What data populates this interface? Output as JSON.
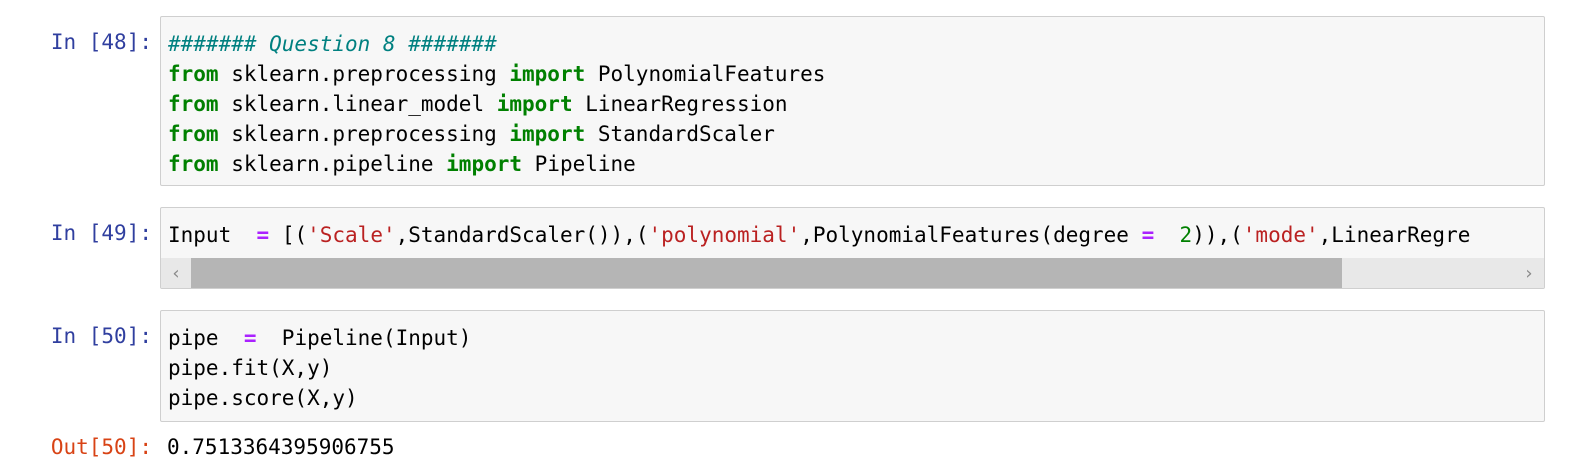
{
  "cells": [
    {
      "prompt": "In [48]:",
      "lines": [
        [
          {
            "t": "####### Question 8 #######",
            "c": "cm"
          }
        ],
        [
          {
            "t": "from",
            "c": "kw"
          },
          {
            "t": " sklearn.preprocessing ",
            "c": ""
          },
          {
            "t": "import",
            "c": "kw"
          },
          {
            "t": " PolynomialFeatures",
            "c": ""
          }
        ],
        [
          {
            "t": "from",
            "c": "kw"
          },
          {
            "t": " sklearn.linear_model ",
            "c": ""
          },
          {
            "t": "import",
            "c": "kw"
          },
          {
            "t": " LinearRegression",
            "c": ""
          }
        ],
        [
          {
            "t": "from",
            "c": "kw"
          },
          {
            "t": " sklearn.preprocessing ",
            "c": ""
          },
          {
            "t": "import",
            "c": "kw"
          },
          {
            "t": " StandardScaler",
            "c": ""
          }
        ],
        [
          {
            "t": "from",
            "c": "kw"
          },
          {
            "t": " sklearn.pipeline ",
            "c": ""
          },
          {
            "t": "import",
            "c": "kw"
          },
          {
            "t": " Pipeline",
            "c": ""
          }
        ]
      ]
    },
    {
      "prompt": "In [49]:",
      "lines": [
        [
          {
            "t": "Input  ",
            "c": ""
          },
          {
            "t": "=",
            "c": "op"
          },
          {
            "t": " [(",
            "c": ""
          },
          {
            "t": "'Scale'",
            "c": "str"
          },
          {
            "t": ",StandardScaler()),(",
            "c": ""
          },
          {
            "t": "'polynomial'",
            "c": "str"
          },
          {
            "t": ",PolynomialFeatures(degree ",
            "c": ""
          },
          {
            "t": "=",
            "c": "op"
          },
          {
            "t": "  ",
            "c": ""
          },
          {
            "t": "2",
            "c": "num"
          },
          {
            "t": ")),(",
            "c": ""
          },
          {
            "t": "'mode'",
            "c": "str"
          },
          {
            "t": ",LinearRegre",
            "c": ""
          }
        ]
      ],
      "scroll": {
        "left_arrow": "‹",
        "right_arrow": "›",
        "position": 0.87
      }
    },
    {
      "prompt": "In [50]:",
      "lines": [
        [
          {
            "t": "pipe  ",
            "c": ""
          },
          {
            "t": "=",
            "c": "op"
          },
          {
            "t": "  Pipeline(Input)",
            "c": ""
          }
        ],
        [
          {
            "t": "pipe.fit(X,y)",
            "c": ""
          }
        ],
        [
          {
            "t": "pipe.score(X,y)",
            "c": ""
          }
        ]
      ]
    }
  ],
  "output": {
    "prompt": "Out[50]:",
    "value": "0.7513364395906755"
  }
}
